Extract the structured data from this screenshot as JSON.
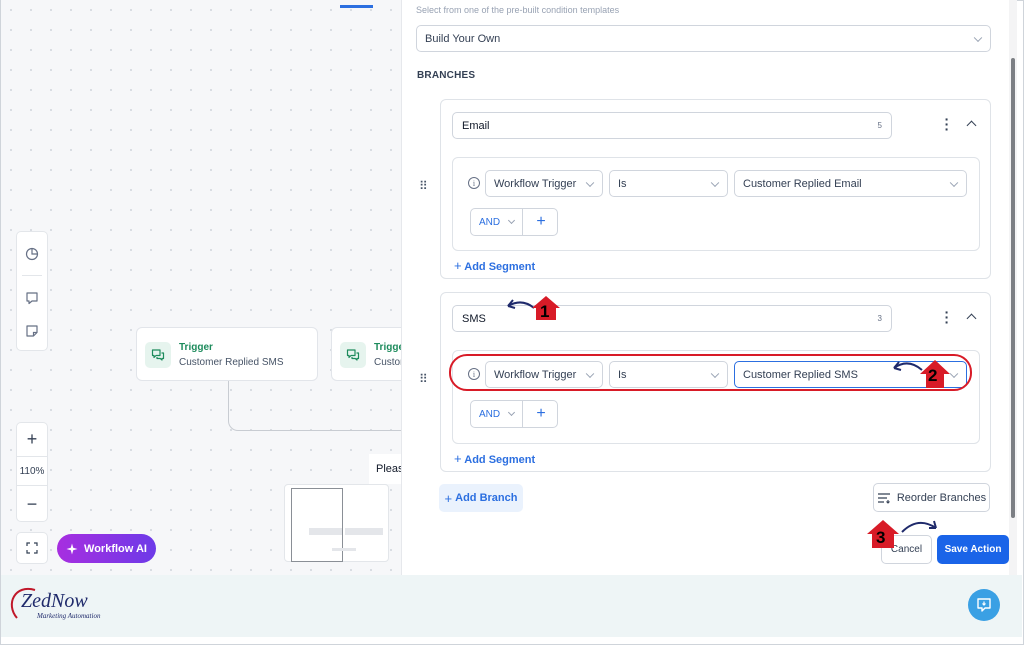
{
  "canvas": {
    "trigger_node_1": {
      "title": "Trigger",
      "subtitle": "Customer Replied SMS"
    },
    "trigger_node_2": {
      "title": "Trigger",
      "subtitle": "Customer Replied SMS"
    },
    "zoom_level": "110%",
    "workflow_ai_label": "Workflow AI",
    "tooltip_fragment": "Pleas"
  },
  "panel": {
    "helper_text": "Select from one of the pre-built condition templates",
    "template_select": "Build Your Own",
    "branches_heading": "BRANCHES",
    "branches": [
      {
        "name": "Email",
        "count": "5",
        "condition": {
          "field": "Workflow Trigger",
          "operator": "Is",
          "value": "Customer Replied Email"
        },
        "and_label": "AND",
        "add_segment": "Add Segment"
      },
      {
        "name": "SMS",
        "count": "3",
        "condition": {
          "field": "Workflow Trigger",
          "operator": "Is",
          "value": "Customer Replied SMS"
        },
        "and_label": "AND",
        "add_segment": "Add Segment"
      }
    ],
    "add_branch": "Add Branch",
    "reorder_branches": "Reorder Branches",
    "cancel": "Cancel",
    "save_action": "Save Action"
  },
  "annotations": {
    "step1": "1",
    "step2": "2",
    "step3": "3"
  },
  "brand": {
    "logo_main": "ZedNow",
    "logo_tagline": "Marketing Automation"
  },
  "colors": {
    "accent": "#1a64e8",
    "highlight": "#d81b27",
    "trigger_green": "#1d8b5c",
    "ai_purple": "#a72ee0"
  }
}
